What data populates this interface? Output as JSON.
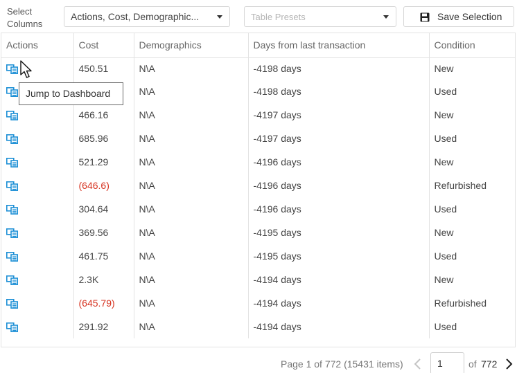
{
  "toolbar": {
    "select_columns_label": "Select Columns",
    "columns_dropdown_value": "Actions, Cost, Demographic...",
    "presets_placeholder": "Table Presets",
    "save_button_label": "Save Selection"
  },
  "table": {
    "columns": [
      "Actions",
      "Cost",
      "Demographics",
      "Days from last transaction",
      "Condition"
    ],
    "action_icon": "jump-to-dashboard-icon",
    "rows": [
      {
        "cost": "450.51",
        "demographics": "N\\A",
        "days": "-4198 days",
        "condition": "New",
        "negative": false
      },
      {
        "cost": "",
        "demographics": "N\\A",
        "days": "-4198 days",
        "condition": "Used",
        "negative": false
      },
      {
        "cost": "466.16",
        "demographics": "N\\A",
        "days": "-4197 days",
        "condition": "New",
        "negative": false
      },
      {
        "cost": "685.96",
        "demographics": "N\\A",
        "days": "-4197 days",
        "condition": "Used",
        "negative": false
      },
      {
        "cost": "521.29",
        "demographics": "N\\A",
        "days": "-4196 days",
        "condition": "New",
        "negative": false
      },
      {
        "cost": "(646.6)",
        "demographics": "N\\A",
        "days": "-4196 days",
        "condition": "Refurbished",
        "negative": true
      },
      {
        "cost": "304.64",
        "demographics": "N\\A",
        "days": "-4196 days",
        "condition": "Used",
        "negative": false
      },
      {
        "cost": "369.56",
        "demographics": "N\\A",
        "days": "-4195 days",
        "condition": "New",
        "negative": false
      },
      {
        "cost": "461.75",
        "demographics": "N\\A",
        "days": "-4195 days",
        "condition": "Used",
        "negative": false
      },
      {
        "cost": "2.3K",
        "demographics": "N\\A",
        "days": "-4194 days",
        "condition": "New",
        "negative": false
      },
      {
        "cost": "(645.79)",
        "demographics": "N\\A",
        "days": "-4194 days",
        "condition": "Refurbished",
        "negative": true
      },
      {
        "cost": "291.92",
        "demographics": "N\\A",
        "days": "-4194 days",
        "condition": "Used",
        "negative": false
      }
    ]
  },
  "tooltip": {
    "text": "Jump to Dashboard"
  },
  "pager": {
    "info": "Page 1 of 772 (15431 items)",
    "current_page": "1",
    "of_label": "of",
    "total_pages": "772"
  },
  "colors": {
    "icon_blue": "#1e90d6",
    "negative_red": "#d6321f",
    "border": "#e2e2e2"
  }
}
